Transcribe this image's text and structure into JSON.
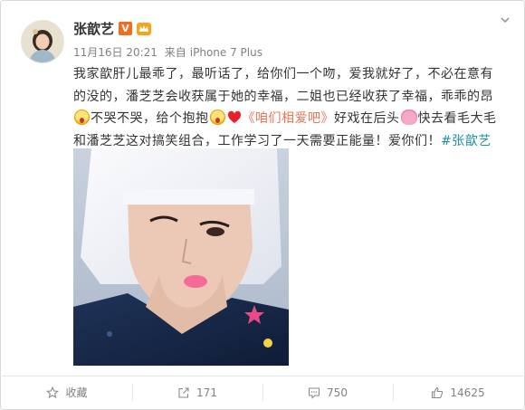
{
  "user": {
    "name": "张歆艺",
    "verified_badge": "V"
  },
  "meta": {
    "date": "11月16日 20:21",
    "from_label": "来自",
    "device": "iPhone 7 Plus"
  },
  "post": {
    "p1": "我家歆肝儿最乖了，最听话了，给你们一个吻，爱我就好了，不必在意有的没的，潘芝芝会收获属于她的幸福，二姐也已经收获了幸福，乖乖的昂",
    "p2": "不哭不哭，给个抱抱",
    "link": "《咱们相爱吧》",
    "p3": "好戏在后头",
    "p4": "快去看毛大毛和潘芝芝这对搞笑组合，工作学习了一天需要正能量！爱你们！",
    "hashtag": "#张歆艺咱们相爱吧#"
  },
  "actions": [
    {
      "label": "收藏",
      "icon": "star-icon"
    },
    {
      "label": "171",
      "icon": "forward-icon"
    },
    {
      "label": "750",
      "icon": "comment-icon"
    },
    {
      "label": "14625",
      "icon": "like-icon"
    }
  ],
  "colors": {
    "link": "#eb7350",
    "hashtag": "#1e8fa0",
    "meta": "#808080",
    "verified": "#f26b1f"
  }
}
